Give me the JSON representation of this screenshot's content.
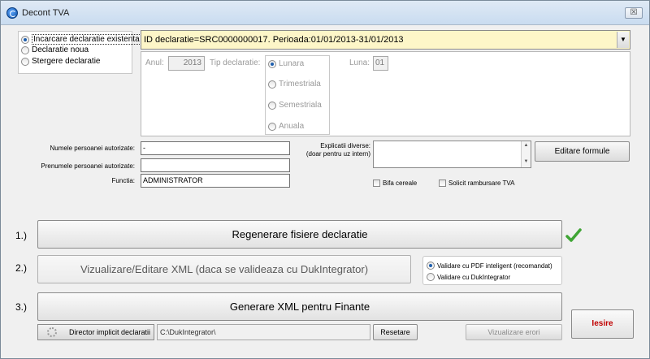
{
  "window": {
    "title": "Decont TVA",
    "close_glyph": "☒"
  },
  "mode": {
    "options": [
      {
        "label": "Incarcare declaratie existenta",
        "selected": true
      },
      {
        "label": "Declaratie noua",
        "selected": false
      },
      {
        "label": "Stergere declaratie",
        "selected": false
      }
    ]
  },
  "declaration_select": {
    "value": "ID declaratie=SRC0000000017. Perioada:01/01/2013-31/01/2013",
    "arrow": "▼"
  },
  "period": {
    "year_label": "Anul:",
    "year_value": "2013",
    "type_label": "Tip declaratie:",
    "types": [
      {
        "label": "Lunara",
        "selected": true
      },
      {
        "label": "Trimestriala",
        "selected": false
      },
      {
        "label": "Semestriala",
        "selected": false
      },
      {
        "label": "Anuala",
        "selected": false
      }
    ],
    "month_label": "Luna:",
    "month_value": "01"
  },
  "person": {
    "name_label": "Numele persoanei autorizate:",
    "name_value": "-",
    "firstname_label": "Prenumele persoanei autorizate:",
    "firstname_value": "",
    "function_label": "Functia:",
    "function_value": "ADMINISTRATOR"
  },
  "notes": {
    "label_line1": "Explicatii diverse:",
    "label_line2": "(doar pentru uz intern)",
    "value": "",
    "scroll_up": "▲",
    "scroll_down": "▼"
  },
  "edit_formulas_button": "Editare formule",
  "checkboxes": {
    "cereale": "Bifa cereale",
    "rambursare": "Solicit rambursare TVA"
  },
  "steps": {
    "s1": {
      "number": "1.)",
      "label": "Regenerare fisiere declaratie"
    },
    "s2": {
      "number": "2.)",
      "label": "Vizualizare/Editare XML (daca se valideaza cu DukIntegrator)"
    },
    "s3": {
      "number": "3.)",
      "label": "Generare XML pentru Finante"
    }
  },
  "validation": {
    "options": [
      {
        "label": "Validare cu PDF inteligent (recomandat)",
        "selected": true
      },
      {
        "label": "Validare cu DukIntegrator",
        "selected": false
      }
    ]
  },
  "directory": {
    "button": "Director implicit declaratii",
    "path": "C:\\DukIntegrator\\",
    "reset": "Resetare"
  },
  "view_errors_button": "Vizualizare erori",
  "exit_button": "Iesire",
  "colors": {
    "accent_check": "#3fa535",
    "exit_text": "#c00000",
    "combo_bg": "#fdf6c8"
  }
}
